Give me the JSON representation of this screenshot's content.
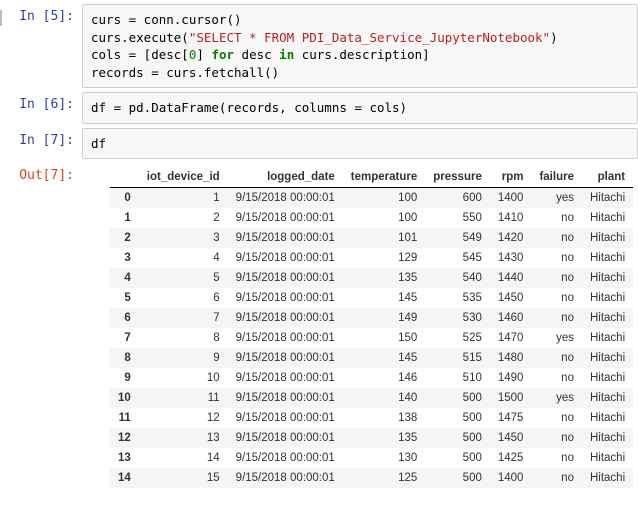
{
  "cells": {
    "c5": {
      "prompt": "In [5]:",
      "code_l1a": "curs = conn.cursor()",
      "code_l2a": "curs.execute(",
      "code_l2b": "\"SELECT * FROM PDI_Data_Service_JupyterNotebook\"",
      "code_l2c": ")",
      "code_l3a": "cols = [desc[",
      "code_l3b": "0",
      "code_l3c": "] ",
      "code_l3d": "for",
      "code_l3e": " desc ",
      "code_l3f": "in",
      "code_l3g": " curs.description]",
      "code_l4a": "records = curs.fetchall()"
    },
    "c6": {
      "prompt": "In [6]:",
      "code_a": "df = pd.DataFrame(records, columns = cols)"
    },
    "c7": {
      "prompt": "In [7]:",
      "code_a": "df"
    },
    "o7": {
      "prompt": "Out[7]:"
    }
  },
  "chart_data": {
    "type": "table",
    "columns": [
      "iot_device_id",
      "logged_date",
      "temperature",
      "pressure",
      "rpm",
      "failure",
      "plant"
    ],
    "index": [
      "0",
      "1",
      "2",
      "3",
      "4",
      "5",
      "6",
      "7",
      "8",
      "9",
      "10",
      "11",
      "12",
      "13",
      "14"
    ],
    "rows": [
      [
        "1",
        "9/15/2018 00:00:01",
        "100",
        "600",
        "1400",
        "yes",
        "Hitachi"
      ],
      [
        "2",
        "9/15/2018 00:00:01",
        "100",
        "550",
        "1410",
        "no",
        "Hitachi"
      ],
      [
        "3",
        "9/15/2018 00:00:01",
        "101",
        "549",
        "1420",
        "no",
        "Hitachi"
      ],
      [
        "4",
        "9/15/2018 00:00:01",
        "129",
        "545",
        "1430",
        "no",
        "Hitachi"
      ],
      [
        "5",
        "9/15/2018 00:00:01",
        "135",
        "540",
        "1440",
        "no",
        "Hitachi"
      ],
      [
        "6",
        "9/15/2018 00:00:01",
        "145",
        "535",
        "1450",
        "no",
        "Hitachi"
      ],
      [
        "7",
        "9/15/2018 00:00:01",
        "149",
        "530",
        "1460",
        "no",
        "Hitachi"
      ],
      [
        "8",
        "9/15/2018 00:00:01",
        "150",
        "525",
        "1470",
        "yes",
        "Hitachi"
      ],
      [
        "9",
        "9/15/2018 00:00:01",
        "145",
        "515",
        "1480",
        "no",
        "Hitachi"
      ],
      [
        "10",
        "9/15/2018 00:00:01",
        "146",
        "510",
        "1490",
        "no",
        "Hitachi"
      ],
      [
        "11",
        "9/15/2018 00:00:01",
        "140",
        "500",
        "1500",
        "yes",
        "Hitachi"
      ],
      [
        "12",
        "9/15/2018 00:00:01",
        "138",
        "500",
        "1475",
        "no",
        "Hitachi"
      ],
      [
        "13",
        "9/15/2018 00:00:01",
        "135",
        "500",
        "1450",
        "no",
        "Hitachi"
      ],
      [
        "14",
        "9/15/2018 00:00:01",
        "130",
        "500",
        "1425",
        "no",
        "Hitachi"
      ],
      [
        "15",
        "9/15/2018 00:00:01",
        "125",
        "500",
        "1400",
        "no",
        "Hitachi"
      ]
    ]
  }
}
